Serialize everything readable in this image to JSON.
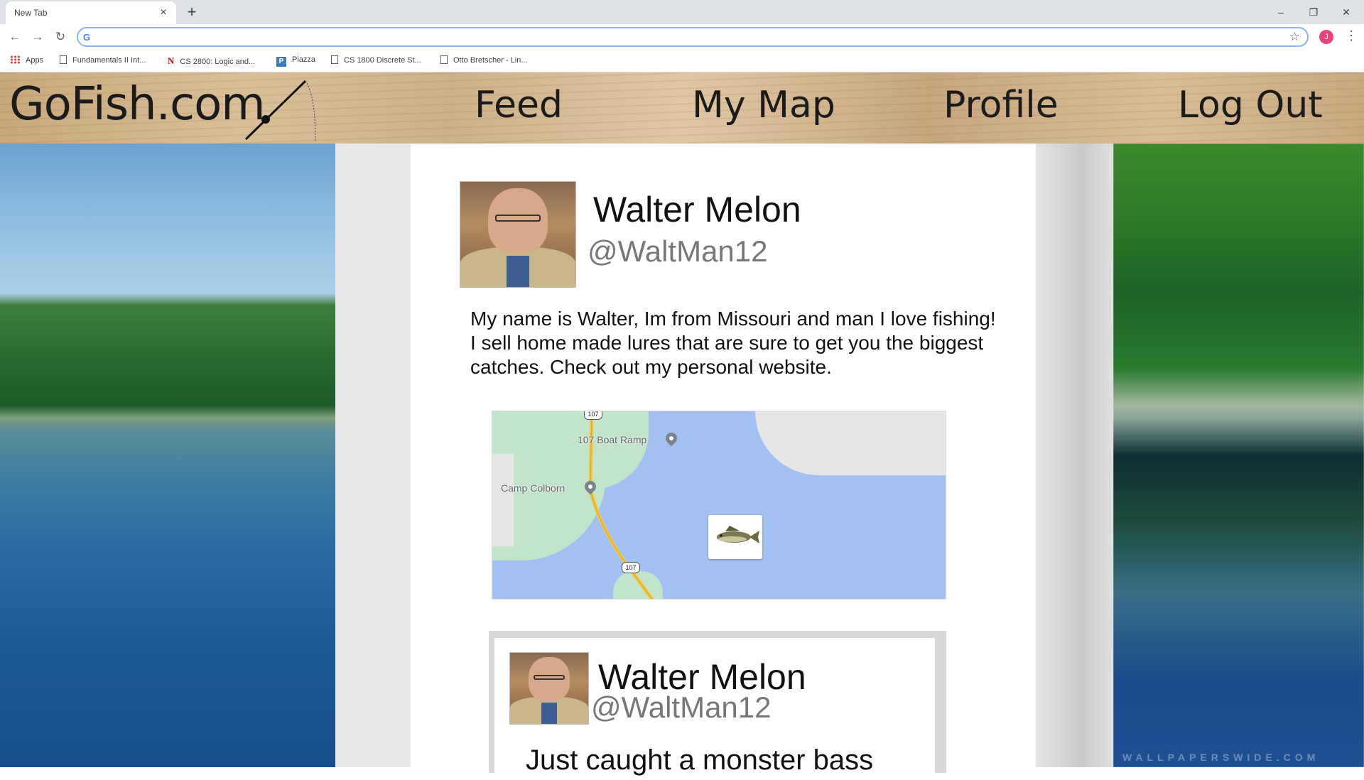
{
  "browser": {
    "tab_title": "New Tab",
    "tab_close": "×",
    "new_tab": "+",
    "window_controls": {
      "minimize": "–",
      "restore": "❐",
      "close": "✕"
    },
    "nav": {
      "back": "←",
      "forward": "→",
      "reload": "↻"
    },
    "address_value": "",
    "profile_initial": "J",
    "bookmarks": [
      {
        "label": "Apps",
        "icon": "apps-grid-icon"
      },
      {
        "label": "Fundamentals II Int...",
        "icon": "page-icon"
      },
      {
        "label": "CS 2800: Logic and...",
        "icon": "n-logo-icon"
      },
      {
        "label": "Piazza",
        "icon": "piazza-icon"
      },
      {
        "label": "CS 1800 Discrete St...",
        "icon": "page-icon"
      },
      {
        "label": "Otto Bretscher - Lin...",
        "icon": "page-icon"
      }
    ]
  },
  "site": {
    "logo": "GoFish.com",
    "nav": [
      "Feed",
      "My Map",
      "Profile",
      "Log Out"
    ]
  },
  "profile": {
    "name": "Walter Melon",
    "handle": "@WaltMan12",
    "bio": "My name is Walter, Im from Missouri and man I love fishing! I sell home made lures that are sure to get you the biggest catches. Check out my personal website."
  },
  "map": {
    "labels": [
      "107 Boat Ramp",
      "Camp Colborn"
    ],
    "route_shields": [
      "107",
      "107"
    ],
    "marker_icon": "bass-fish-icon"
  },
  "post": {
    "name": "Walter Melon",
    "handle": "@WaltMan12",
    "text": "Just caught a monster bass"
  },
  "colors": {
    "header_wood": "#d2b38b",
    "water": "#a2c1f2",
    "land": "#c2e4cb",
    "road": "#f4c542"
  }
}
